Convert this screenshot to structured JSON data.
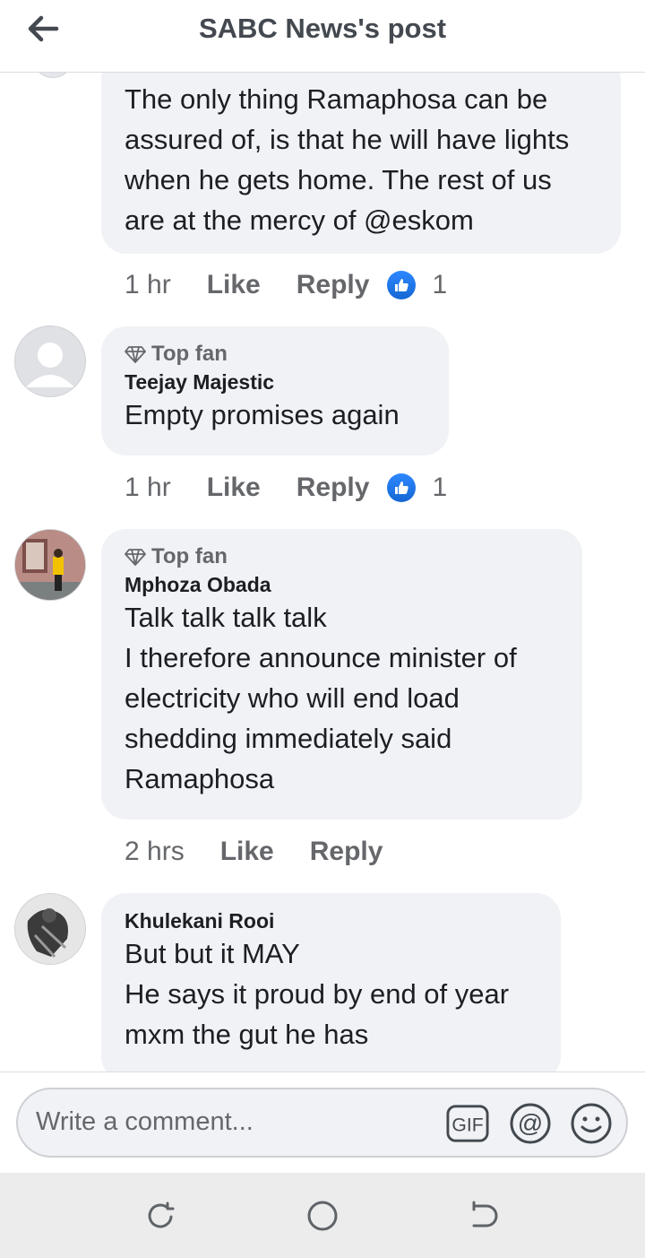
{
  "header": {
    "title": "SABC News's post",
    "back_icon": "arrow-left-icon"
  },
  "comments": [
    {
      "top_fan": false,
      "author": "",
      "text": "The only thing Ramaphosa can be assured of, is that he will have lights when he gets home. The rest of us are at the mercy of @eskom",
      "time": "1 hr",
      "like_label": "Like",
      "reply_label": "Reply",
      "reaction_count": "1"
    },
    {
      "top_fan": true,
      "top_fan_label": "Top fan",
      "author": "Teejay Majestic",
      "text": "Empty promises again",
      "time": "1 hr",
      "like_label": "Like",
      "reply_label": "Reply",
      "reaction_count": "1"
    },
    {
      "top_fan": true,
      "top_fan_label": "Top fan",
      "author": "Mphoza Obada",
      "text": "Talk talk talk talk\nI therefore announce minister of electricity who will end load shedding immediately said Ramaphosa",
      "time": "2 hrs",
      "like_label": "Like",
      "reply_label": "Reply"
    },
    {
      "top_fan": false,
      "author": "Khulekani Rooi",
      "text": "But but it MAY\nHe says it proud by end of year mxm the gut he has"
    }
  ],
  "composer": {
    "placeholder": "Write a comment...",
    "gif_label": "GIF",
    "mention_icon": "at-icon",
    "emoji_icon": "smiley-icon"
  },
  "colors": {
    "accent": "#1877f2",
    "bubble": "#f0f2f5",
    "secondary_text": "#65676b"
  }
}
